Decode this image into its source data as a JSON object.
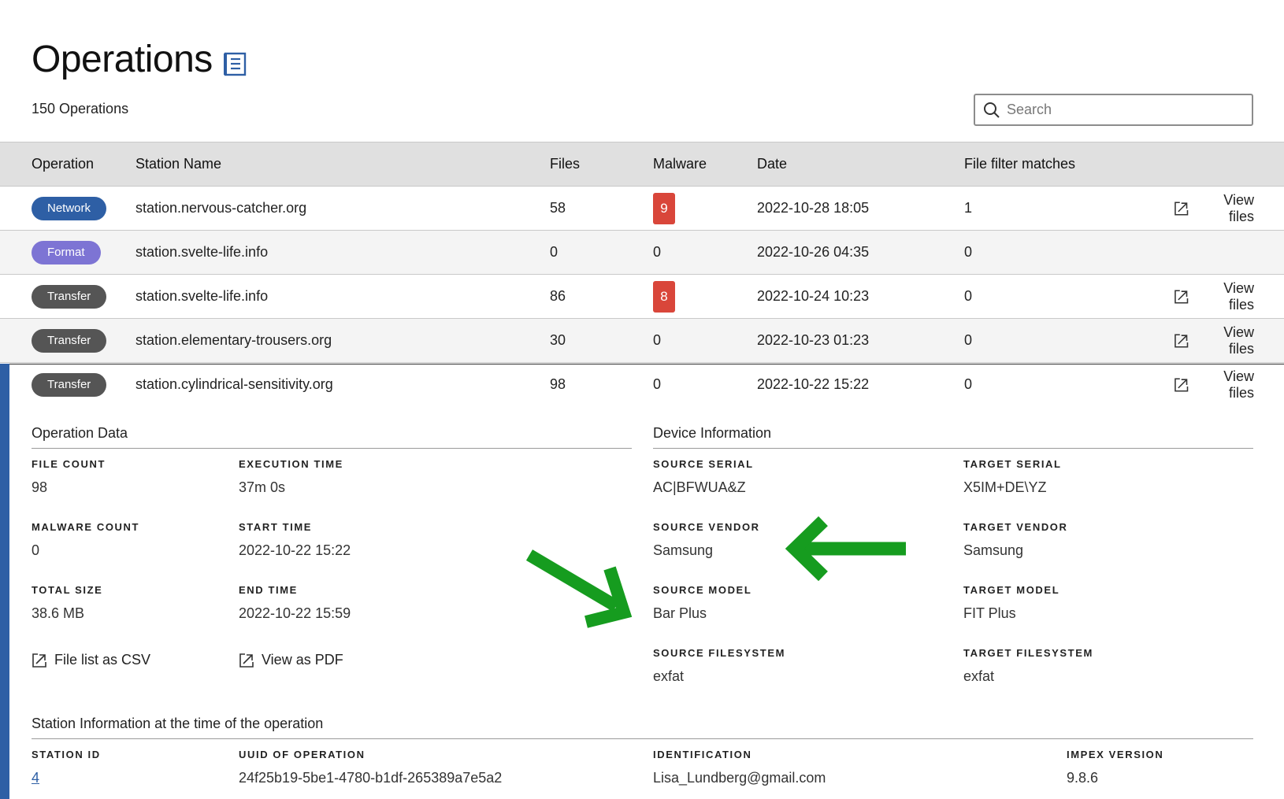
{
  "header": {
    "title": "Operations",
    "doc_icon": "document-icon"
  },
  "summary": {
    "count_text": "150 Operations"
  },
  "search": {
    "placeholder": "Search",
    "icon": "search-icon"
  },
  "table": {
    "columns": {
      "operation": "Operation",
      "station": "Station Name",
      "files": "Files",
      "malware": "Malware",
      "date": "Date",
      "filter": "File filter matches"
    },
    "rows": [
      {
        "operation": "Network",
        "op_color": "#2e5fa5",
        "station": "station.nervous-catcher.org",
        "files": "58",
        "malware": "9",
        "malware_flag": true,
        "date": "2022-10-28 18:05",
        "filter": "1",
        "view_files": "View files"
      },
      {
        "operation": "Format",
        "op_color": "#7d74d4",
        "station": "station.svelte-life.info",
        "files": "0",
        "malware": "0",
        "malware_flag": false,
        "date": "2022-10-26 04:35",
        "filter": "0",
        "view_files": ""
      },
      {
        "operation": "Transfer",
        "op_color": "#555555",
        "station": "station.svelte-life.info",
        "files": "86",
        "malware": "8",
        "malware_flag": true,
        "date": "2022-10-24 10:23",
        "filter": "0",
        "view_files": "View files"
      },
      {
        "operation": "Transfer",
        "op_color": "#555555",
        "station": "station.elementary-trousers.org",
        "files": "30",
        "malware": "0",
        "malware_flag": false,
        "date": "2022-10-23 01:23",
        "filter": "0",
        "view_files": "View files"
      },
      {
        "operation": "Transfer",
        "op_color": "#555555",
        "station": "station.cylindrical-sensitivity.org",
        "files": "98",
        "malware": "0",
        "malware_flag": false,
        "date": "2022-10-22 15:22",
        "filter": "0",
        "view_files": "View files"
      }
    ]
  },
  "operation_data": {
    "title": "Operation Data",
    "file_count": {
      "label": "FILE COUNT",
      "value": "98"
    },
    "execution_time": {
      "label": "EXECUTION TIME",
      "value": "37m 0s"
    },
    "malware_count": {
      "label": "MALWARE COUNT",
      "value": "0"
    },
    "start_time": {
      "label": "START TIME",
      "value": "2022-10-22 15:22"
    },
    "total_size": {
      "label": "TOTAL SIZE",
      "value": "38.6 MB"
    },
    "end_time": {
      "label": "END TIME",
      "value": "2022-10-22 15:59"
    },
    "csv_link": "File list as CSV",
    "pdf_link": "View as PDF"
  },
  "device_information": {
    "title": "Device Information",
    "source_serial": {
      "label": "SOURCE SERIAL",
      "value": "AC|BFWUA&Z"
    },
    "target_serial": {
      "label": "TARGET SERIAL",
      "value": "X5IM+DE\\YZ"
    },
    "source_vendor": {
      "label": "SOURCE VENDOR",
      "value": "Samsung"
    },
    "target_vendor": {
      "label": "TARGET VENDOR",
      "value": "Samsung"
    },
    "source_model": {
      "label": "SOURCE MODEL",
      "value": "Bar Plus"
    },
    "target_model": {
      "label": "TARGET MODEL",
      "value": "FIT Plus"
    },
    "source_filesystem": {
      "label": "SOURCE FILESYSTEM",
      "value": "exfat"
    },
    "target_filesystem": {
      "label": "TARGET FILESYSTEM",
      "value": "exfat"
    }
  },
  "station_information": {
    "title": "Station Information at the time of the operation",
    "station_id": {
      "label": "STATION ID",
      "value": "4"
    },
    "uuid": {
      "label": "UUID OF OPERATION",
      "value": "24f25b19-5be1-4780-b1df-265389a7e5a2"
    },
    "identification": {
      "label": "IDENTIFICATION",
      "value": "Lisa_Lundberg@gmail.com"
    },
    "impex_version": {
      "label": "IMPEX VERSION",
      "value": "9.8.6"
    }
  },
  "colors": {
    "accent": "#2e5fa5",
    "malware": "#d9463a",
    "annotation_arrow": "#169c1f"
  }
}
